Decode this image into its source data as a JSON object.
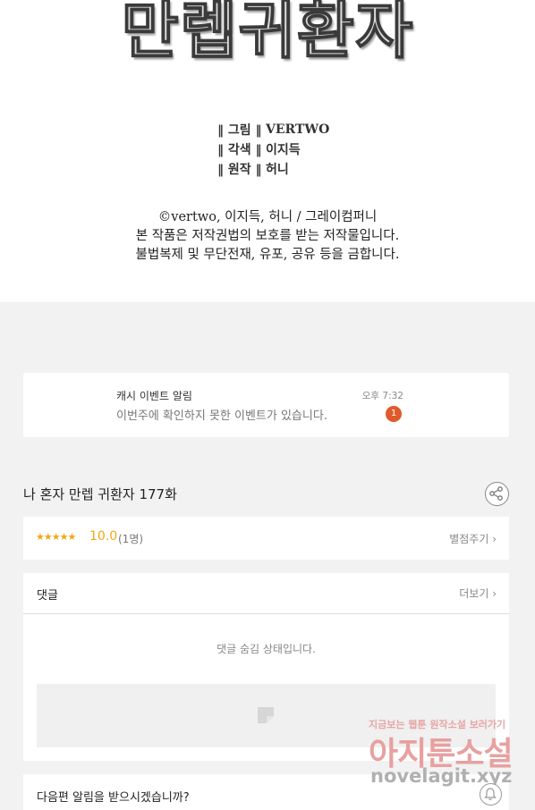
{
  "comic": {
    "title": "만렙귀환자",
    "credits": [
      {
        "role": "‖ 그림 ‖",
        "name": "VERTWO"
      },
      {
        "role": "‖ 각색 ‖",
        "name": "이지득"
      },
      {
        "role": "‖ 원작 ‖",
        "name": "허니"
      }
    ],
    "copyright_lines": [
      "©vertwo, 이지득, 허니 / 그레이컴퍼니",
      "본 작품은 저작권법의 보호를 받는 저작물입니다.",
      "불법복제 및 무단전재, 유포, 공유 등을 금합니다."
    ]
  },
  "notification": {
    "title": "캐시 이벤트 알림",
    "message": "이번주에 확인하지 못한 이벤트가 있습니다.",
    "time": "오후 7:32",
    "badge": "1"
  },
  "episode": {
    "title": "나 혼자 만렙 귀환자 177화",
    "share_icon": "share-icon"
  },
  "rating": {
    "stars": "★★★★★",
    "score": "10.0",
    "count": "(1명)",
    "rate_link": "별점주기 ›"
  },
  "comments": {
    "label": "댓글",
    "more_link": "더보기 ›",
    "hidden_message": "댓글 숨김 상태입니다."
  },
  "next_alert": {
    "label": "다음편 알림을 받으시겠습니까?",
    "icon": "bell-icon"
  },
  "watermark": {
    "line1": "지금보는 웹툰 원작소설 보러가기",
    "line2": "아지툰소설",
    "line3": "novelagit.xyz"
  },
  "colors": {
    "accent_star": "#f3a712",
    "badge": "#e05a2b"
  }
}
